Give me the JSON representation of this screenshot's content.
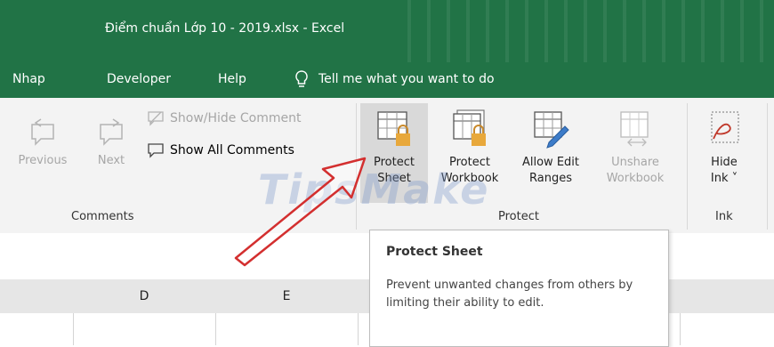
{
  "window": {
    "title": "Điểm chuẩn Lớp 10 - 2019.xlsx  -  Excel"
  },
  "tabs": [
    {
      "label": "Nhap"
    },
    {
      "label": "Developer"
    },
    {
      "label": "Help"
    }
  ],
  "tell_me": {
    "text": "Tell me what you want to do"
  },
  "ribbon": {
    "comments_group": {
      "label": "Comments",
      "previous": "Previous",
      "next": "Next",
      "show_hide": "Show/Hide Comment",
      "show_all": "Show All Comments"
    },
    "protect_group": {
      "label": "Protect",
      "protect_sheet": {
        "line1": "Protect",
        "line2": "Sheet"
      },
      "protect_workbook": {
        "line1": "Protect",
        "line2": "Workbook"
      },
      "allow_edit": {
        "line1": "Allow Edit",
        "line2": "Ranges"
      },
      "unshare": {
        "line1": "Unshare",
        "line2": "Workbook"
      }
    },
    "ink_group": {
      "label": "Ink",
      "hide_ink": {
        "line1": "Hide",
        "line2": "Ink ˅"
      }
    }
  },
  "grid": {
    "columns": [
      "D",
      "E"
    ]
  },
  "tooltip": {
    "title": "Protect Sheet",
    "body": "Prevent unwanted changes from others by limiting their ability to edit."
  },
  "watermark": {
    "text": "TipsMake"
  },
  "colors": {
    "excel_green": "#217346",
    "ribbon_bg": "#f3f3f3",
    "lock_gold": "#e8a83b"
  }
}
